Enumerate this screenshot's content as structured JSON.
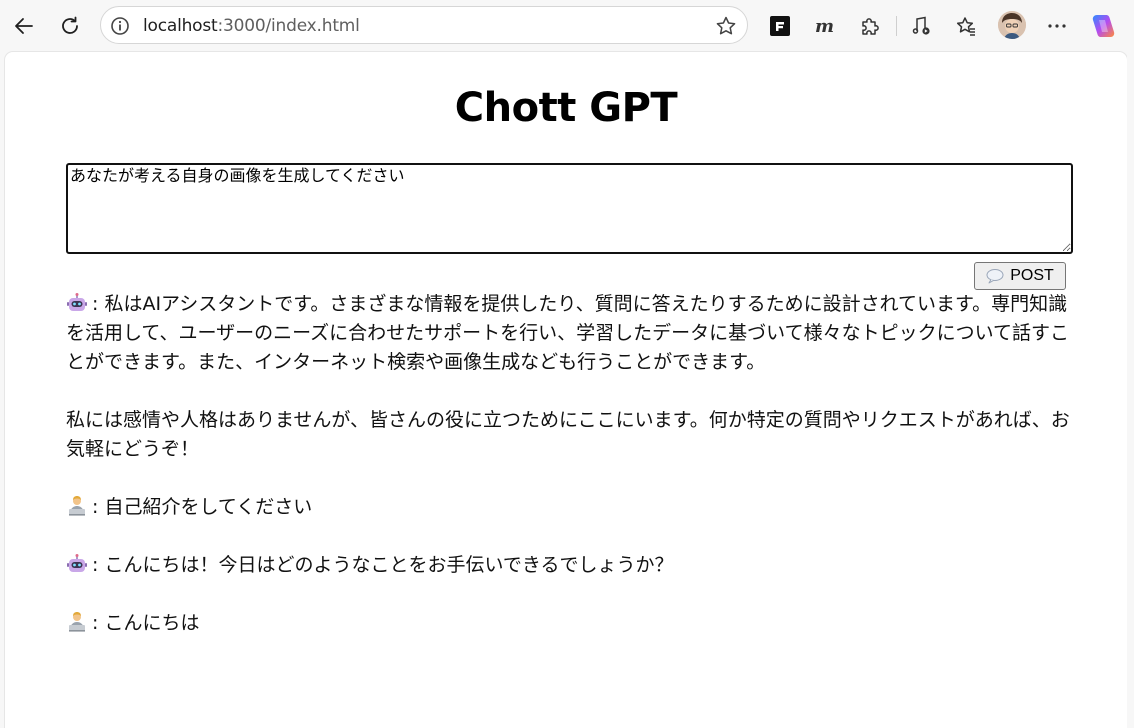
{
  "browser": {
    "url_host": "localhost",
    "url_rest": ":3000/index.html",
    "toolbar_icons": [
      "back-icon",
      "reload-icon",
      "site-info-icon",
      "favorite-star-icon",
      "extension-f-icon",
      "extension-m-icon",
      "extensions-puzzle-icon",
      "media-control-icon",
      "favorites-icon",
      "profile-avatar",
      "more-menu-icon",
      "copilot-icon"
    ]
  },
  "page": {
    "title": "Chott GPT",
    "input": {
      "value": "あなたが考える自身の画像を生成してください"
    },
    "post_button": {
      "icon": "speech-bubble-icon",
      "label": "POST"
    },
    "messages": [
      {
        "role": "assistant",
        "icon": "robot-icon",
        "paragraphs": [
          ": 私はAIアシスタントです。さまざまな情報を提供したり、質問に答えたりするために設計されています。専門知識を活用して、ユーザーのニーズに合わせたサポートを行い、学習したデータに基づいて様々なトピックについて話すことができます。また、インターネット検索や画像生成なども行うことができます。",
          "私には感情や人格はありませんが、皆さんの役に立つためにここにいます。何か特定の質問やリクエストがあれば、お気軽にどうぞ！"
        ]
      },
      {
        "role": "user",
        "icon": "person-at-laptop-icon",
        "paragraphs": [
          ": 自己紹介をしてください"
        ]
      },
      {
        "role": "assistant",
        "icon": "robot-icon",
        "paragraphs": [
          ": こんにちは！今日はどのようなことをお手伝いできるでしょうか？"
        ]
      },
      {
        "role": "user",
        "icon": "person-at-laptop-icon",
        "paragraphs": [
          ": こんにちは"
        ]
      }
    ]
  },
  "colors": {
    "chrome_bg": "#f7f7f7",
    "page_bg": "#ffffff",
    "text": "#111111",
    "button_bg": "#efefef"
  }
}
